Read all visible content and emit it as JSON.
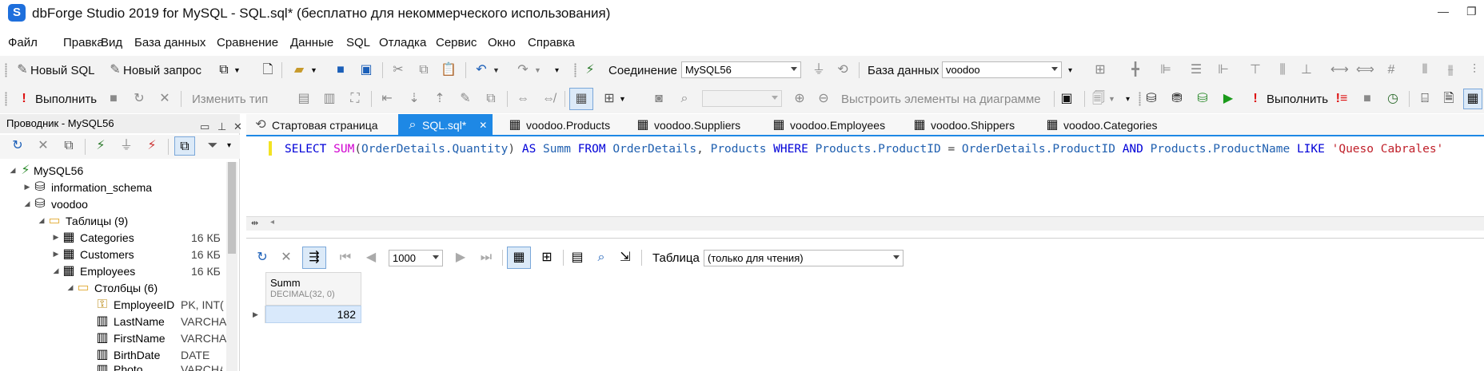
{
  "window": {
    "logo_letter": "S",
    "title": "dbForge Studio 2019 for MySQL - SQL.sql* (бесплатно для некоммерческого использования)",
    "minimize_glyph": "—",
    "restore_glyph": "❐"
  },
  "menu": [
    "Файл",
    "Правка",
    "Вид",
    "База данных",
    "Сравнение",
    "Данные",
    "SQL",
    "Отладка",
    "Сервис",
    "Окно",
    "Справка"
  ],
  "toolbar1": {
    "new_sql": "Новый SQL",
    "new_query": "Новый запрос",
    "connection_label": "Соединение",
    "connection_value": "MySQL56",
    "database_label": "База данных",
    "database_value": "voodoo"
  },
  "toolbar2": {
    "execute": "Выполнить",
    "change_type": "Изменить тип",
    "build_diagram": "Выстроить элементы на диаграмме",
    "execute2": "Выполнить"
  },
  "explorer": {
    "title": "Проводник - MySQL56",
    "tree": [
      {
        "label": "MySQL56",
        "expanded": true,
        "icon": "connection-icon"
      },
      {
        "label": "information_schema",
        "expanded": false,
        "icon": "database-icon"
      },
      {
        "label": "voodoo",
        "expanded": true,
        "icon": "database-icon"
      },
      {
        "label": "Таблицы (9)",
        "expanded": true,
        "icon": "folder-icon"
      },
      {
        "label": "Categories",
        "size": "16 КБ",
        "expanded": false,
        "icon": "table-icon"
      },
      {
        "label": "Customers",
        "size": "16 КБ",
        "expanded": false,
        "icon": "table-icon"
      },
      {
        "label": "Employees",
        "size": "16 КБ",
        "expanded": true,
        "icon": "table-icon"
      },
      {
        "label": "Столбцы (6)",
        "expanded": true,
        "icon": "folder-icon"
      },
      {
        "label": "EmployeeID",
        "size": "PK, INT(",
        "icon": "primary-key-column-icon"
      },
      {
        "label": "LastName",
        "size": "VARCHA",
        "icon": "column-icon"
      },
      {
        "label": "FirstName",
        "size": "VARCHA",
        "icon": "column-icon"
      },
      {
        "label": "BirthDate",
        "size": "DATE",
        "icon": "column-icon"
      },
      {
        "label": "Photo",
        "size": "VARCHA",
        "icon": "column-icon"
      }
    ]
  },
  "tabs": [
    {
      "label": "Стартовая страница",
      "active": false,
      "icon": "start-page-icon"
    },
    {
      "label": "SQL.sql*",
      "active": true,
      "icon": "sql-file-icon",
      "close": "✕"
    },
    {
      "label": "voodoo.Products",
      "active": false,
      "icon": "table-icon"
    },
    {
      "label": "voodoo.Suppliers",
      "active": false,
      "icon": "table-icon"
    },
    {
      "label": "voodoo.Employees",
      "active": false,
      "icon": "table-icon"
    },
    {
      "label": "voodoo.Shippers",
      "active": false,
      "icon": "table-icon"
    },
    {
      "label": "voodoo.Categories",
      "active": false,
      "icon": "table-icon"
    }
  ],
  "editor": {
    "tokens": [
      {
        "t": "SELECT ",
        "c": "kw"
      },
      {
        "t": "SUM",
        "c": "fn"
      },
      {
        "t": "(",
        "c": "op"
      },
      {
        "t": "OrderDetails.Quantity",
        "c": "id"
      },
      {
        "t": ") ",
        "c": "op"
      },
      {
        "t": "AS ",
        "c": "kw"
      },
      {
        "t": "Summ ",
        "c": "id"
      },
      {
        "t": "FROM ",
        "c": "kw"
      },
      {
        "t": "OrderDetails",
        "c": "id"
      },
      {
        "t": ", ",
        "c": "op"
      },
      {
        "t": "Products ",
        "c": "id"
      },
      {
        "t": "WHERE ",
        "c": "kw"
      },
      {
        "t": "Products.ProductID ",
        "c": "id"
      },
      {
        "t": "= ",
        "c": "op"
      },
      {
        "t": "OrderDetails.ProductID ",
        "c": "id"
      },
      {
        "t": "AND ",
        "c": "kw"
      },
      {
        "t": "Products.ProductName ",
        "c": "id"
      },
      {
        "t": "LIKE ",
        "c": "kw"
      },
      {
        "t": "'Queso Cabrales'",
        "c": "str"
      }
    ]
  },
  "results": {
    "page_size": "1000",
    "view_label": "Таблица",
    "view_value": "(только для чтения)",
    "columns": [
      {
        "name": "Summ",
        "type": "DECIMAL(32, 0)"
      }
    ],
    "rows": [
      [
        "182"
      ]
    ]
  },
  "colors": {
    "accent": "#1e88e5",
    "selected_cell": "#d9e9fb",
    "keyword": "#0000d8",
    "function": "#d000d0",
    "identifier": "#2060b0",
    "string": "#c0202a"
  }
}
